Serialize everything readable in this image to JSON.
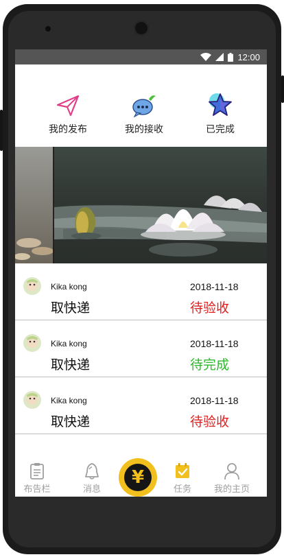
{
  "status_bar": {
    "time": "12:00"
  },
  "top_nav": [
    {
      "label": "我的发布",
      "icon": "paper-plane-icon"
    },
    {
      "label": "我的接收",
      "icon": "chat-bubble-icon"
    },
    {
      "label": "已完成",
      "icon": "star-icon"
    }
  ],
  "tasks": [
    {
      "name": "Kika kong",
      "date": "2018-11-18",
      "title": "取快递",
      "status": "待验收",
      "status_color": "#e02020"
    },
    {
      "name": "Kika kong",
      "date": "2018-11-18",
      "title": "取快递",
      "status": "待完成",
      "status_color": "#2db82d"
    },
    {
      "name": "Kika kong",
      "date": "2018-11-18",
      "title": "取快递",
      "status": "待验收",
      "status_color": "#e02020"
    }
  ],
  "bottom_nav": {
    "items": [
      {
        "label": "布告栏",
        "icon": "clipboard-icon"
      },
      {
        "label": "消息",
        "icon": "bell-icon"
      },
      {
        "label": "任务",
        "icon": "calendar-check-icon",
        "active": true
      },
      {
        "label": "我的主页",
        "icon": "user-icon"
      }
    ],
    "center_symbol": "¥"
  },
  "colors": {
    "accent": "#f2c01e",
    "pending": "#e02020",
    "done": "#2db82d"
  }
}
